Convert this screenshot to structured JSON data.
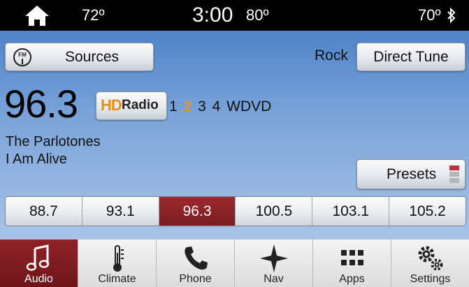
{
  "status_bar": {
    "outside_temp": "72º",
    "time": "3:00",
    "driver_temp": "80º",
    "passenger_temp": "70º",
    "icons": {
      "home": "home-icon",
      "bluetooth": "bluetooth-icon"
    }
  },
  "radio": {
    "sources_label": "Sources",
    "sources_icon_text": "FM",
    "genre": "Rock",
    "direct_tune_label": "Direct Tune",
    "frequency": "96.3",
    "hd_logo": {
      "hd": "HD",
      "radio": "Radio"
    },
    "hd_channels": [
      "1",
      "2",
      "3",
      "4"
    ],
    "active_hd_channel": "2",
    "station_name": "WDVD",
    "artist": "The Parlotones",
    "song": "I Am Alive",
    "presets_label": "Presets",
    "preset_indicator_colors": [
      "#c0303a",
      "#b5b5b5",
      "#b5b5b5"
    ],
    "presets": [
      "88.7",
      "93.1",
      "96.3",
      "100.5",
      "103.1",
      "105.2"
    ],
    "selected_preset": "96.3"
  },
  "nav": {
    "items": [
      {
        "label": "Audio",
        "icon": "music-note-icon",
        "active": true
      },
      {
        "label": "Climate",
        "icon": "thermometer-icon",
        "active": false
      },
      {
        "label": "Phone",
        "icon": "phone-icon",
        "active": false
      },
      {
        "label": "Nav",
        "icon": "compass-star-icon",
        "active": false
      },
      {
        "label": "Apps",
        "icon": "apps-grid-icon",
        "active": false
      },
      {
        "label": "Settings",
        "icon": "gears-icon",
        "active": false
      }
    ]
  },
  "colors": {
    "accent_red": "#7a1c20",
    "hd_orange": "#f0901c"
  }
}
